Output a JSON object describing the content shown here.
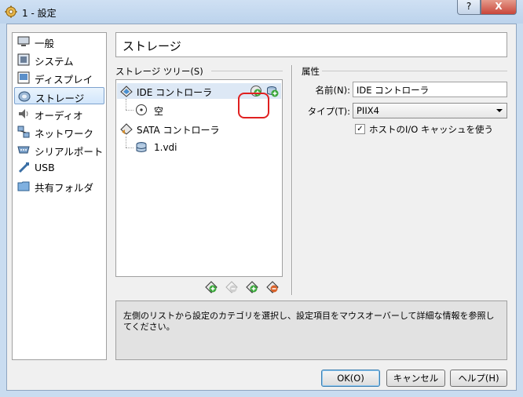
{
  "window": {
    "title": "1 - 設定",
    "help_button": "?",
    "close_button": "X"
  },
  "sidebar": {
    "selected_index": 3,
    "items": [
      {
        "label": "一般",
        "icon": "monitor-icon"
      },
      {
        "label": "システム",
        "icon": "chip-icon"
      },
      {
        "label": "ディスプレイ",
        "icon": "display-icon"
      },
      {
        "label": "ストレージ",
        "icon": "storage-icon"
      },
      {
        "label": "オーディオ",
        "icon": "speaker-icon"
      },
      {
        "label": "ネットワーク",
        "icon": "network-icon"
      },
      {
        "label": "シリアルポート",
        "icon": "serial-port-icon"
      },
      {
        "label": "USB",
        "icon": "usb-icon"
      },
      {
        "label": "共有フォルダ",
        "icon": "folder-icon"
      }
    ]
  },
  "page": {
    "title": "ストレージ"
  },
  "storage_tree": {
    "group_label": "ストレージ ツリー(S)",
    "nodes": [
      {
        "label": "IDE コントローラ",
        "icon": "ide-controller-icon",
        "selected": true
      },
      {
        "label": "空",
        "icon": "cd-empty-icon"
      },
      {
        "label": "SATA コントローラ",
        "icon": "sata-controller-icon"
      },
      {
        "label": "1.vdi",
        "icon": "hard-disk-icon"
      }
    ],
    "toolbar": [
      {
        "name": "add-controller-button",
        "icon": "add-controller-icon"
      },
      {
        "name": "remove-controller-button",
        "icon": "remove-controller-icon"
      },
      {
        "name": "add-attachment-button",
        "icon": "add-attachment-icon"
      },
      {
        "name": "remove-attachment-button",
        "icon": "remove-attachment-icon"
      }
    ]
  },
  "attributes": {
    "group_label": "属性",
    "name_label": "名前(N):",
    "name_value": "IDE コントローラ",
    "type_label": "タイプ(T):",
    "type_value": "PIIX4",
    "host_io_label": "ホストのI/O キャッシュを使う",
    "host_io_checked": true
  },
  "info": {
    "text": "左側のリストから設定のカテゴリを選択し、設定項目をマウスオーバーして詳細な情報を参照してください。"
  },
  "buttons": {
    "ok": "OK(O)",
    "cancel": "キャンセル",
    "help": "ヘルプ(H)"
  },
  "colors": {
    "titlebar": "#c9dcf0",
    "close": "#c9463a",
    "selection": "#d2e6fb",
    "highlight_ring": "#e02020"
  }
}
